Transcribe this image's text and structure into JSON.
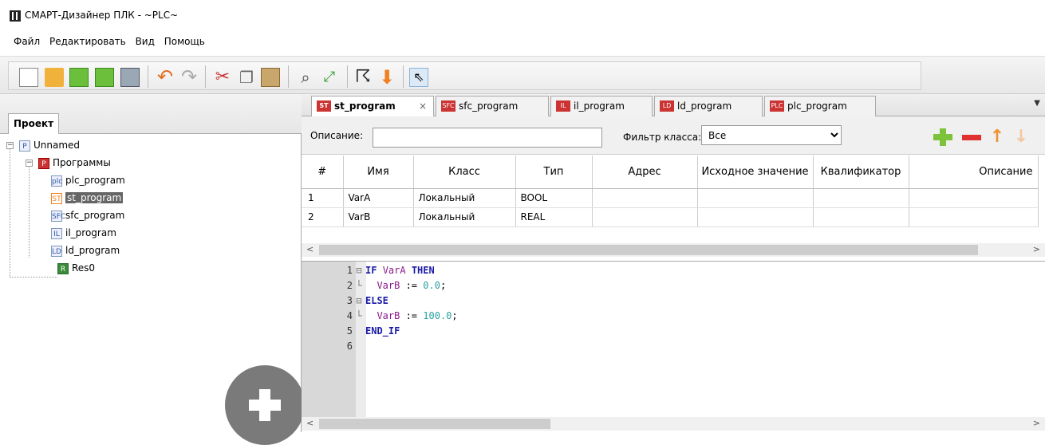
{
  "window": {
    "title": "СМАРТ-Дизайнер ПЛК - ~PLC~"
  },
  "menu": [
    "Файл",
    "Редактировать",
    "Вид",
    "Помощь"
  ],
  "toolbar": {
    "icons": [
      "new-file-icon",
      "open-folder-icon",
      "save-icon",
      "save-all-icon",
      "print-icon",
      "undo-icon",
      "redo-icon",
      "cut-icon",
      "copy-icon",
      "paste-icon",
      "zoom-icon",
      "fit-icon",
      "run-icon",
      "download-icon",
      "pointer-icon"
    ]
  },
  "project": {
    "tab": "Проект",
    "root": "Unnamed",
    "programs_folder": "Программы",
    "items": [
      "plc_program",
      "st_program",
      "sfc_program",
      "il_program",
      "ld_program"
    ],
    "item_badges": [
      "plc",
      "ST",
      "SFC",
      "IL",
      "LD"
    ],
    "resource": "Res0",
    "selected": "st_program"
  },
  "tabs": [
    {
      "label": "st_program",
      "badge": "ST",
      "active": true
    },
    {
      "label": "sfc_program",
      "badge": "SFC"
    },
    {
      "label": "il_program",
      "badge": "IL"
    },
    {
      "label": "ld_program",
      "badge": "LD"
    },
    {
      "label": "plc_program",
      "badge": "PLC"
    }
  ],
  "filter": {
    "description_label": "Описание:",
    "description_value": "",
    "class_label": "Фильтр класса:",
    "class_value": "Все"
  },
  "vars_table": {
    "columns": [
      "#",
      "Имя",
      "Класс",
      "Тип",
      "Адрес",
      "Исходное значение",
      "Квалификатор",
      "Описание"
    ],
    "rows": [
      [
        "1",
        "VarA",
        "Локальный",
        "BOOL",
        "",
        "",
        "",
        ""
      ],
      [
        "2",
        "VarB",
        "Локальный",
        "REAL",
        "",
        "",
        "",
        ""
      ]
    ]
  },
  "code": {
    "line_numbers": [
      "1",
      "2",
      "3",
      "4",
      "5",
      "6"
    ],
    "lines": [
      "IF VarA THEN",
      "  VarB := 0.0;",
      "ELSE",
      "  VarB := 100.0;",
      "END_IF",
      ""
    ]
  }
}
